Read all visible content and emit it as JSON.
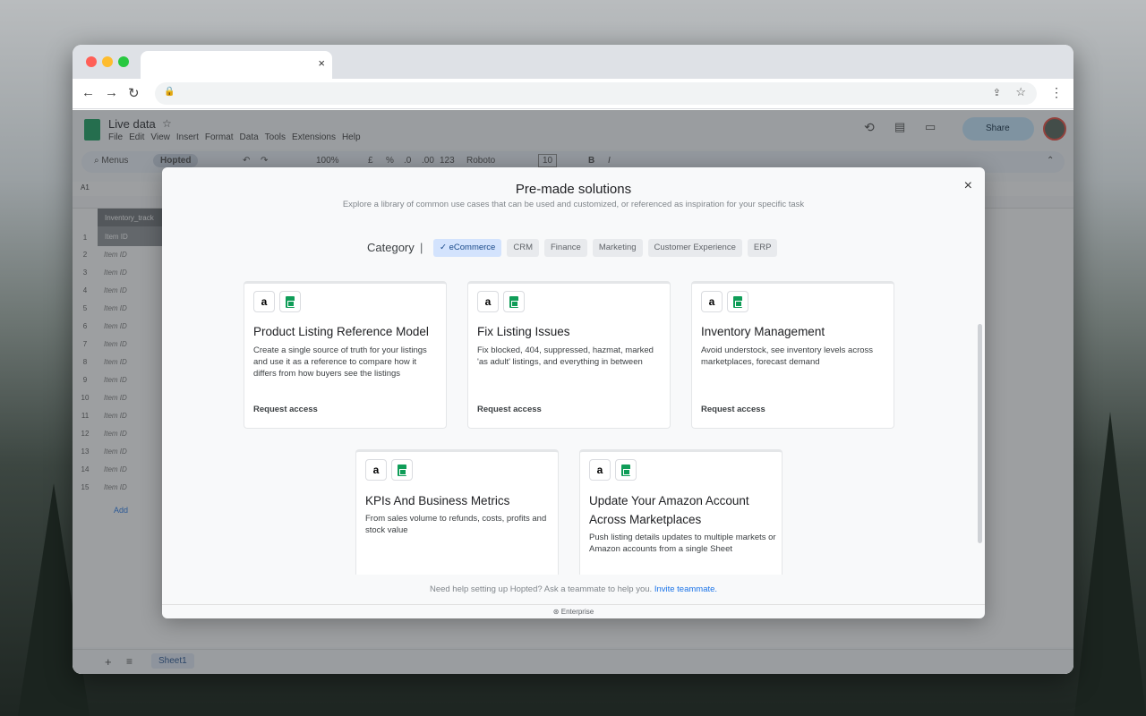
{
  "browser": {
    "tab_close": "×",
    "back": "←",
    "forward": "→",
    "reload": "↻"
  },
  "sheets": {
    "title": "Live data",
    "menu": [
      "File",
      "Edit",
      "View",
      "Insert",
      "Format",
      "Data",
      "Tools",
      "Extensions",
      "Help"
    ],
    "share_label": "Share",
    "toolbar": {
      "menus": "Menus",
      "hopted": "Hopted",
      "zoom": "100%",
      "currency": "£",
      "percent": "%",
      "dec_dec": ".0",
      "inc_dec": ".00",
      "number_format": "123",
      "font": "Roboto",
      "font_size": "10"
    },
    "cell_ref": "A1",
    "table_name": "Inventory_track",
    "col_header": "Item ID",
    "rows": [
      "Item ID",
      "Item ID",
      "Item ID",
      "Item ID",
      "Item ID",
      "Item ID",
      "Item ID",
      "Item ID",
      "Item ID",
      "Item ID",
      "Item ID",
      "Item ID",
      "Item ID",
      "Item ID"
    ],
    "row_numbers": [
      "1",
      "2",
      "3",
      "4",
      "5",
      "6",
      "7",
      "8",
      "9",
      "10",
      "11",
      "12",
      "13",
      "14",
      "15"
    ],
    "add_label": "Add",
    "sheet_tab": "Sheet1"
  },
  "modal": {
    "title": "Pre-made solutions",
    "subtitle": "Explore a library of common use cases that can be used and customized, or referenced as inspiration for your specific task",
    "close": "×",
    "category_label": "Category",
    "category_sep": "|",
    "categories": [
      "eCommerce",
      "CRM",
      "Finance",
      "Marketing",
      "Customer Experience",
      "ERP"
    ],
    "active_category": "eCommerce",
    "cards": [
      {
        "title": "Product Listing Reference Model",
        "desc": "Create a single source of truth for your listings and use it as a reference to compare how it differs from how buyers see the listings",
        "link": "Request access"
      },
      {
        "title": "Fix Listing Issues",
        "desc": "Fix blocked, 404, suppressed, hazmat, marked 'as adult' listings, and everything in between",
        "link": "Request access"
      },
      {
        "title": "Inventory Management",
        "desc": "Avoid understock, see inventory levels across marketplaces, forecast demand",
        "link": "Request access"
      },
      {
        "title": "KPIs And Business Metrics",
        "desc": "From sales volume to refunds, costs, profits and stock value",
        "link": ""
      },
      {
        "title": "Update Your Amazon Account Across Marketplaces",
        "desc": "Push listing details updates to multiple markets or Amazon accounts from a single Sheet",
        "link": ""
      }
    ],
    "amazon_glyph": "a",
    "help_text": "Need help setting up Hopted? Ask a teammate to help you.",
    "help_link": "Invite teammate.",
    "enterprise": "Enterprise"
  }
}
